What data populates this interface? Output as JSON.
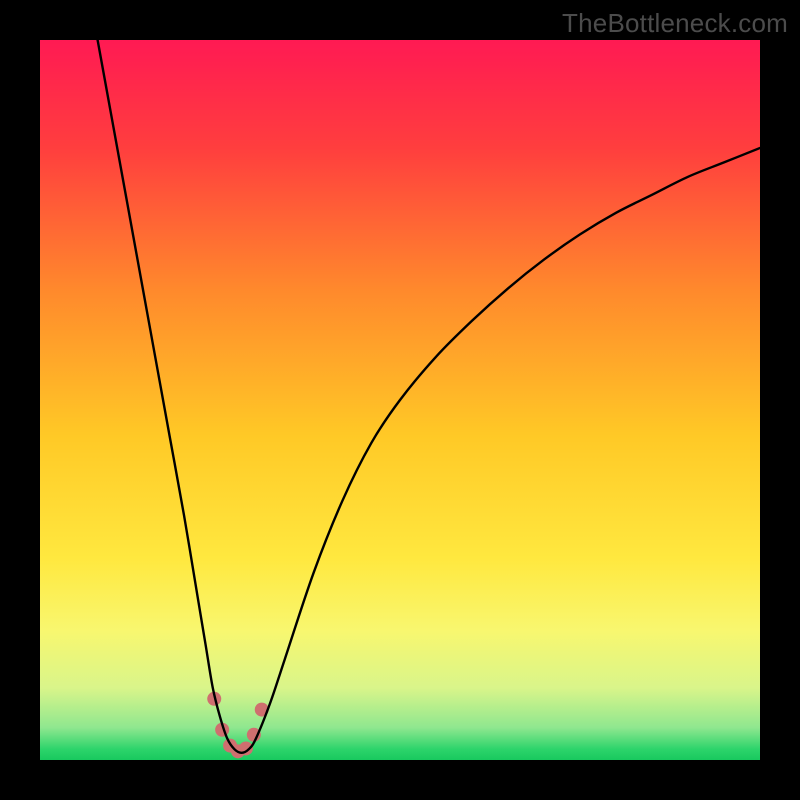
{
  "watermark": "TheBottleneck.com",
  "chart_data": {
    "type": "line",
    "title": "",
    "xlabel": "",
    "ylabel": "",
    "xlim": [
      0,
      100
    ],
    "ylim": [
      0,
      100
    ],
    "grid": false,
    "legend": false,
    "annotations": [],
    "background_gradient_stops": [
      {
        "offset": 0.0,
        "color": "#ff1a53"
      },
      {
        "offset": 0.15,
        "color": "#ff3e3e"
      },
      {
        "offset": 0.35,
        "color": "#ff8a2c"
      },
      {
        "offset": 0.55,
        "color": "#ffc926"
      },
      {
        "offset": 0.72,
        "color": "#ffe83f"
      },
      {
        "offset": 0.82,
        "color": "#f8f76f"
      },
      {
        "offset": 0.9,
        "color": "#d9f58a"
      },
      {
        "offset": 0.955,
        "color": "#8fe78f"
      },
      {
        "offset": 0.985,
        "color": "#2dd46b"
      },
      {
        "offset": 1.0,
        "color": "#18c95e"
      }
    ],
    "series": [
      {
        "name": "bottleneck-curve",
        "color": "#000000",
        "x": [
          8,
          10,
          12,
          14,
          16,
          18,
          20,
          22,
          23,
          24,
          25,
          26,
          27,
          28,
          29,
          30,
          32,
          34,
          38,
          42,
          46,
          50,
          55,
          60,
          65,
          70,
          75,
          80,
          85,
          90,
          95,
          100
        ],
        "values": [
          100,
          89,
          78,
          67,
          56,
          45,
          34,
          22,
          16,
          10,
          6,
          3,
          1.5,
          1,
          1.5,
          3,
          8,
          14,
          26,
          36,
          44,
          50,
          56,
          61,
          65.5,
          69.5,
          73,
          76,
          78.5,
          81,
          83,
          85
        ]
      }
    ],
    "markers": {
      "name": "highlight-dots",
      "color": "#cf6f6f",
      "radius": 7,
      "x": [
        24.2,
        25.3,
        26.4,
        27.5,
        28.6,
        29.7,
        30.8
      ],
      "values": [
        8.5,
        4.2,
        2.0,
        1.2,
        1.6,
        3.5,
        7.0
      ]
    }
  }
}
